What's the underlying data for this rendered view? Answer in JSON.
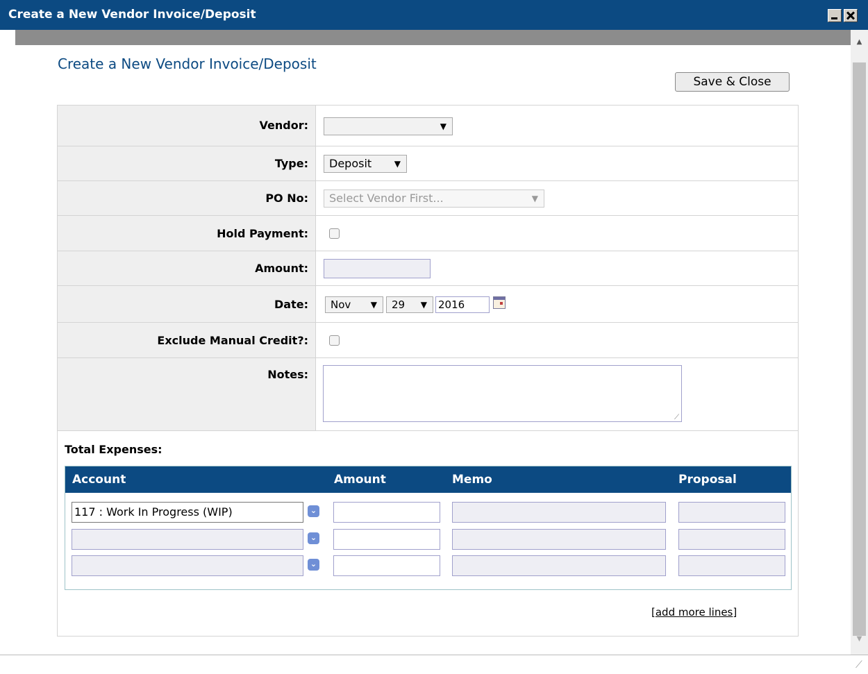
{
  "window": {
    "title": "Create a New Vendor Invoice/Deposit"
  },
  "page": {
    "heading": "Create a New Vendor Invoice/Deposit",
    "save_label": "Save & Close"
  },
  "form": {
    "vendor": {
      "label": "Vendor:",
      "value": ""
    },
    "type": {
      "label": "Type:",
      "value": "Deposit"
    },
    "po_no": {
      "label": "PO No:",
      "placeholder": "Select Vendor First..."
    },
    "hold_payment": {
      "label": "Hold Payment:",
      "checked": false
    },
    "amount": {
      "label": "Amount:",
      "value": ""
    },
    "date": {
      "label": "Date:",
      "month": "Nov",
      "day": "29",
      "year": "2016"
    },
    "exclude_manual_credit": {
      "label": "Exclude Manual Credit?:",
      "checked": false
    },
    "notes": {
      "label": "Notes:",
      "value": ""
    }
  },
  "expenses": {
    "title": "Total Expenses:",
    "columns": [
      "Account",
      "Amount",
      "Memo",
      "Proposal"
    ],
    "rows": [
      {
        "account": "117 : Work In Progress (WIP)",
        "amount": "",
        "memo": "",
        "proposal": ""
      },
      {
        "account": "",
        "amount": "",
        "memo": "",
        "proposal": ""
      },
      {
        "account": "",
        "amount": "",
        "memo": "",
        "proposal": ""
      }
    ],
    "add_more_label": "add more lines"
  },
  "colors": {
    "brand": "#0c4a82",
    "label_bg": "#efefef"
  }
}
